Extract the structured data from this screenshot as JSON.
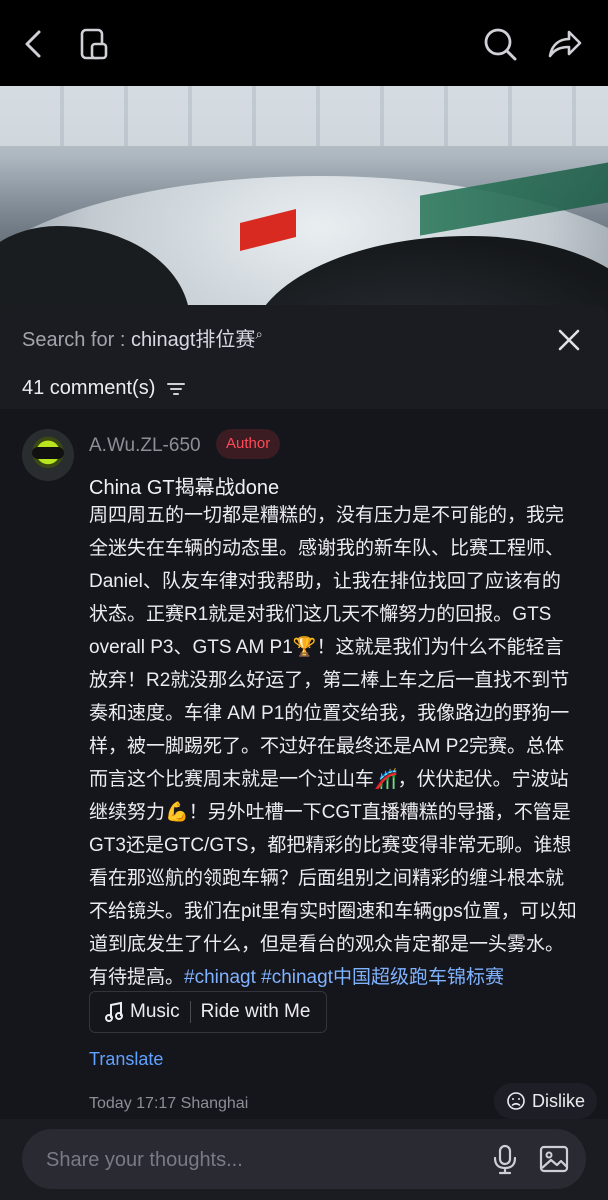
{
  "icons": {
    "back": "chevron-left-icon",
    "copy": "copy-icon",
    "search": "search-icon",
    "share": "share-icon",
    "close": "close-icon",
    "filter": "filter-icon",
    "music": "music-note-icon",
    "dislike": "dislike-face-icon",
    "mic": "microphone-icon",
    "image": "image-icon"
  },
  "search": {
    "prefix": "Search for : ",
    "query": "chinagt排位赛"
  },
  "comments_count": "41 comment(s)",
  "comment": {
    "username": "A.Wu.ZL-650",
    "badge": "Author",
    "title": "China GT揭幕战done",
    "body": "周四周五的一切都是糟糕的，没有压力是不可能的，我完全迷失在车辆的动态里。感谢我的新车队、比赛工程师、Daniel、队友车律对我帮助，让我在排位找回了应该有的状态。正赛R1就是对我们这几天不懈努力的回报。GTS overall P3、GTS AM P1🏆！这就是我们为什么不能轻言放弃！R2就没那么好运了，第二棒上车之后一直找不到节奏和速度。车律 AM P1的位置交给我，我像路边的野狗一样，被一脚踢死了。不过好在最终还是AM P2完赛。总体而言这个比赛周末就是一个过山车🎢，伏伏起伏。宁波站继续努力💪！另外吐槽一下CGT直播糟糕的导播，不管是GT3还是GTC/GTS，都把精彩的比赛变得非常无聊。谁想看在那巡航的领跑车辆？后面组别之间精彩的缠斗根本就不给镜头。我们在pit里有实时圈速和车辆gps位置，可以知道到底发生了什么，但是看台的观众肯定都是一头雾水。有待提高。",
    "hashtags": "#chinagt #chinagt中国超级跑车锦标赛",
    "music_label": "Music",
    "music_title": "Ride with Me",
    "translate": "Translate",
    "time": "Today 17:17",
    "location": "Shanghai",
    "dislike": "Dislike"
  },
  "input": {
    "placeholder": "Share your thoughts..."
  },
  "colors": {
    "accent_link": "#5fa2ff",
    "hashtag": "#7fb2ff",
    "author_badge": "#ff4a57"
  }
}
